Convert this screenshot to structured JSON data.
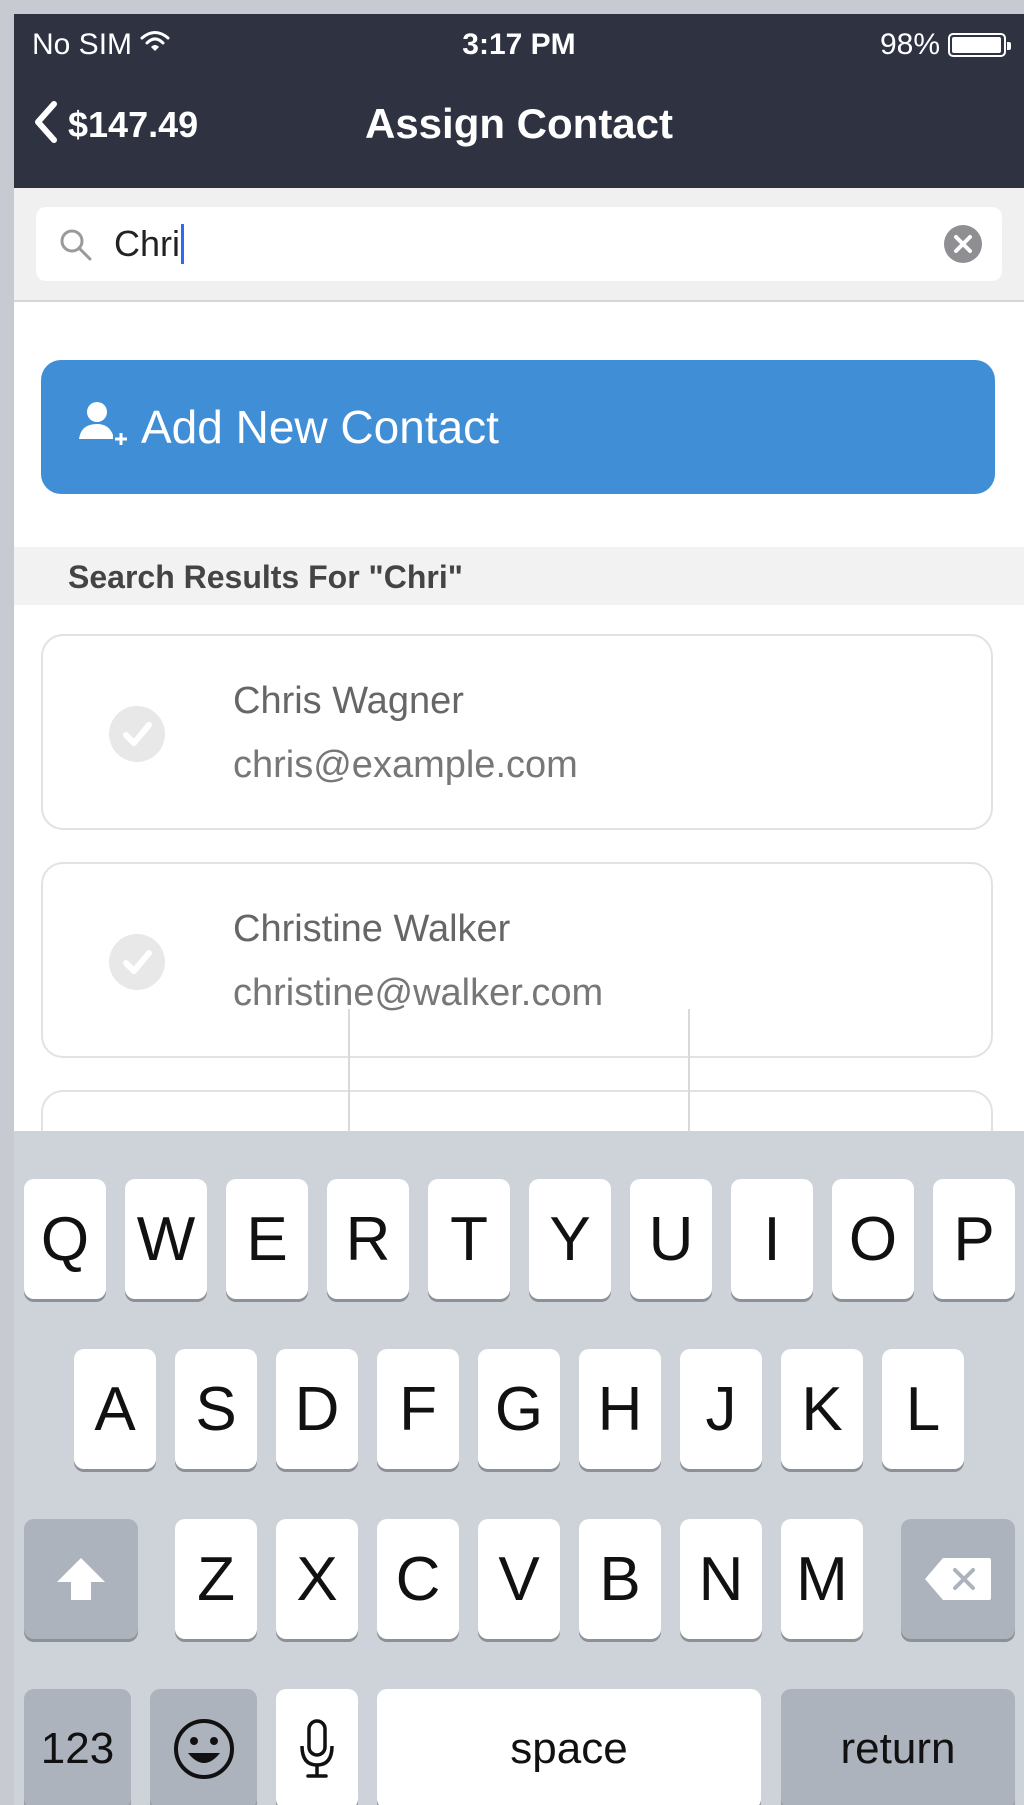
{
  "status_bar": {
    "carrier": "No SIM",
    "time": "3:17 PM",
    "battery": "98%",
    "battery_level": 0.98
  },
  "nav": {
    "back_amount": "$147.49",
    "title": "Assign Contact"
  },
  "search": {
    "value": "Chri"
  },
  "add_contact": {
    "label": "Add New Contact"
  },
  "results": {
    "header": "Search Results For \"Chri\"",
    "items": [
      {
        "name": "Chris Wagner",
        "email": "chris@example.com"
      },
      {
        "name": "Christine Walker",
        "email": "christine@walker.com"
      }
    ]
  },
  "keyboard": {
    "row1": [
      "Q",
      "W",
      "E",
      "R",
      "T",
      "Y",
      "U",
      "I",
      "O",
      "P"
    ],
    "row2": [
      "A",
      "S",
      "D",
      "F",
      "G",
      "H",
      "J",
      "K",
      "L"
    ],
    "row3": [
      "Z",
      "X",
      "C",
      "V",
      "B",
      "N",
      "M"
    ],
    "numbers_label": "123",
    "space_label": "space",
    "return_label": "return"
  },
  "colors": {
    "nav_bg": "#2e3241",
    "accent": "#3f8ed6",
    "keyboard_bg": "#ced2d9"
  }
}
